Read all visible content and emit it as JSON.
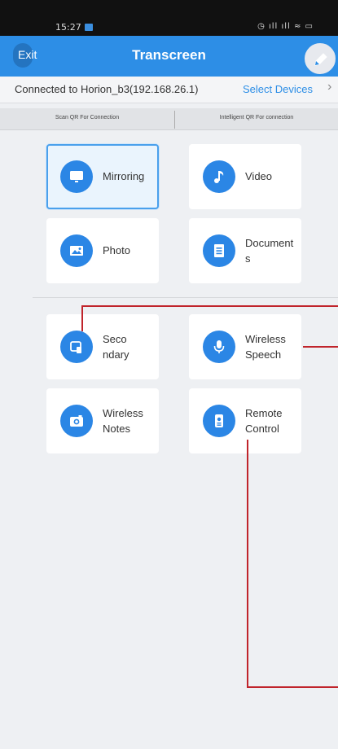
{
  "status_bar": {
    "time": "15:27",
    "indicators": "◷ ıll ıll ≈ ▭"
  },
  "header": {
    "exit_label": "Exit",
    "title": "Transcreen"
  },
  "connection": {
    "status": "Connected to Horion_b3(192.168.26.1)",
    "select_devices": "Select Devices",
    "chevron": "›"
  },
  "qr_tabs": {
    "scan": "Scan QR For Connection",
    "intelligent": "Intelligent QR For connection"
  },
  "features": [
    {
      "label": "Mirroring",
      "icon": "monitor-icon",
      "selected": true
    },
    {
      "label": "Video",
      "icon": "music-note-icon"
    },
    {
      "label": "Photo",
      "icon": "image-icon"
    },
    {
      "label": "Document\ns",
      "icon": "document-icon"
    },
    {
      "label": "Seco\nndary",
      "icon": "secondary-screen-icon"
    },
    {
      "label": "Wireless\nSpeech",
      "icon": "microphone-icon"
    },
    {
      "label": "Wireless\nNotes",
      "icon": "camera-icon"
    },
    {
      "label": "Remote\nControl",
      "icon": "remote-control-icon"
    }
  ],
  "colors": {
    "accent": "#2d8ee6",
    "annotation": "#c0242b",
    "background": "#eef0f3"
  }
}
